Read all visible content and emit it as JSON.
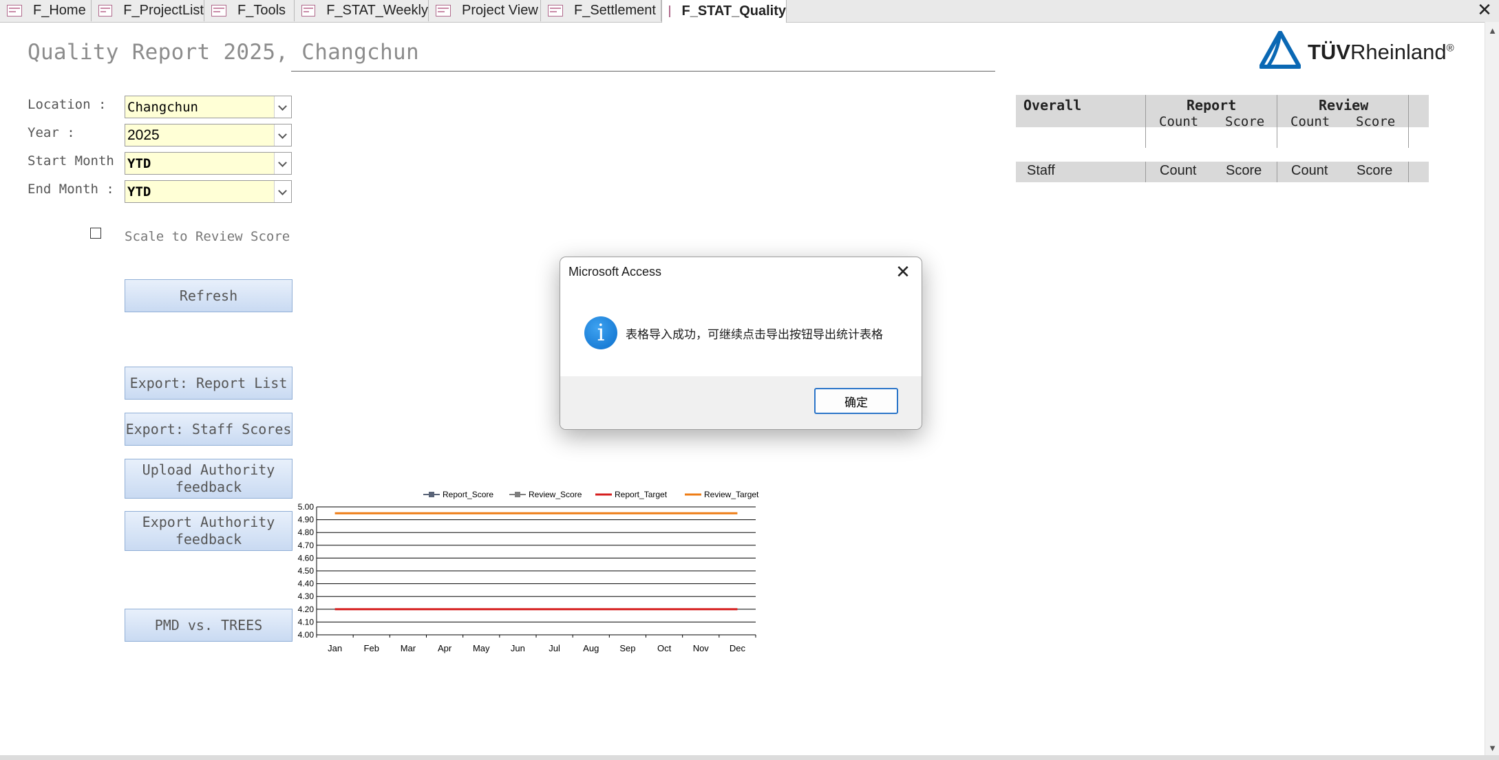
{
  "tabs": [
    {
      "label": "F_Home",
      "active": false
    },
    {
      "label": "F_ProjectList",
      "active": false
    },
    {
      "label": "F_Tools",
      "active": false
    },
    {
      "label": "F_STAT_Weekly",
      "active": false
    },
    {
      "label": "Project View",
      "active": false
    },
    {
      "label": "F_Settlement",
      "active": false
    },
    {
      "label": "F_STAT_Quality",
      "active": true
    }
  ],
  "header": {
    "title": "Quality Report 2025, Changchun",
    "logo_text_bold": "TÜV",
    "logo_text": "Rheinland",
    "logo_reg": "®",
    "brand_color": "#0a68b4"
  },
  "filters": {
    "location_label": "Location :",
    "location_value": "Changchun",
    "year_label": "Year :",
    "year_value": "2025",
    "start_month_label": "Start Month",
    "start_month_value": "YTD",
    "end_month_label": "End Month :",
    "end_month_value": "YTD",
    "scale_label": "Scale to Review Score",
    "scale_checked": false
  },
  "buttons": {
    "refresh": "Refresh",
    "export_report_list": "Export: Report List",
    "export_staff_scores": "Export: Staff Scores",
    "upload_feedback_1": "Upload Authority",
    "upload_feedback_2": "feedback",
    "export_feedback_1": "Export Authority",
    "export_feedback_2": "feedback",
    "pmd_trees": "PMD vs. TREES"
  },
  "summary_table": {
    "overall": "Overall",
    "report": "Report",
    "review": "Review",
    "count": "Count",
    "score": "Score"
  },
  "staff_table": {
    "staff": "Staff",
    "count": "Count",
    "score": "Score"
  },
  "chart_data": {
    "type": "line",
    "categories": [
      "Jan",
      "Feb",
      "Mar",
      "Apr",
      "May",
      "Jun",
      "Jul",
      "Aug",
      "Sep",
      "Oct",
      "Nov",
      "Dec"
    ],
    "series": [
      {
        "name": "Report_Score",
        "values": [],
        "color": "#5a6478"
      },
      {
        "name": "Review_Score",
        "values": [],
        "color": "#7f7f7f"
      },
      {
        "name": "Report_Target",
        "values": [
          4.2,
          4.2,
          4.2,
          4.2,
          4.2,
          4.2,
          4.2,
          4.2,
          4.2,
          4.2,
          4.2,
          4.2
        ],
        "color": "#d61f1f"
      },
      {
        "name": "Review_Target",
        "values": [
          4.95,
          4.95,
          4.95,
          4.95,
          4.95,
          4.95,
          4.95,
          4.95,
          4.95,
          4.95,
          4.95,
          4.95
        ],
        "color": "#ee7d16"
      }
    ],
    "y_ticks": [
      "5.00",
      "4.90",
      "4.80",
      "4.70",
      "4.60",
      "4.50",
      "4.40",
      "4.30",
      "4.20",
      "4.10",
      "4.00"
    ],
    "ylim": [
      4.0,
      5.0
    ],
    "grid": true,
    "legend": "top"
  },
  "dialog": {
    "title": "Microsoft Access",
    "message": "表格导入成功，可继续点击导出按钮导出统计表格",
    "ok_label": "确定",
    "icon": "info-icon"
  }
}
